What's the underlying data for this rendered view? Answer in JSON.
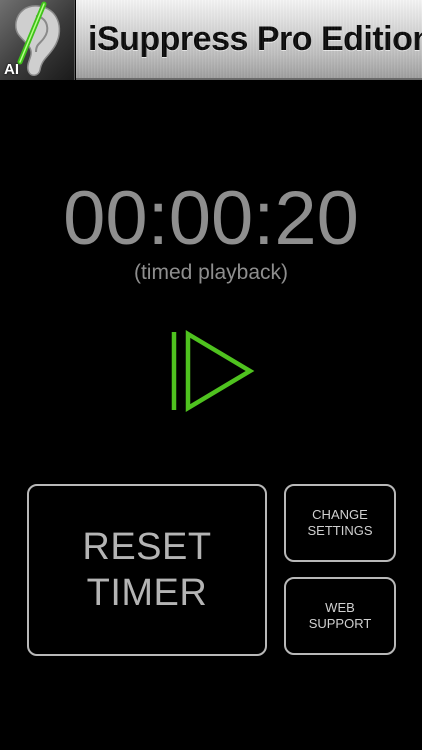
{
  "header": {
    "icon_label": "AI",
    "title": "iSuppress Pro Edition"
  },
  "timer": {
    "value": "00:00:20",
    "caption": "(timed playback)"
  },
  "controls": {
    "play_icon": "play-icon",
    "accent_color": "#4fc21f"
  },
  "buttons": {
    "reset": {
      "line1": "RESET",
      "line2": "TIMER"
    },
    "change_settings": {
      "line1": "CHANGE",
      "line2": "SETTINGS"
    },
    "web_support": {
      "line1": "WEB",
      "line2": "SUPPORT"
    }
  }
}
